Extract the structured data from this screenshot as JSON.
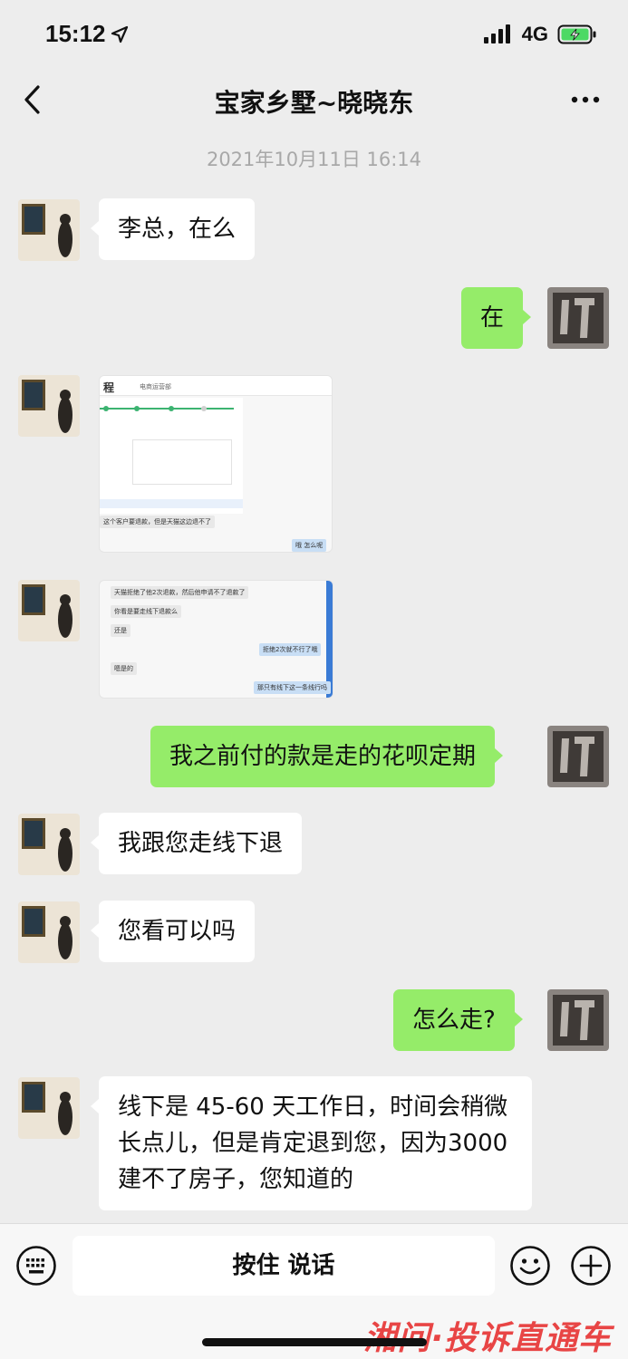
{
  "status": {
    "time": "15:12",
    "network": "4G"
  },
  "header": {
    "title": "宝家乡墅~晓晓东"
  },
  "chat": {
    "timestamp": "2021年10月11日 16:14",
    "messages": [
      {
        "side": "left",
        "type": "text",
        "text": "李总，在么"
      },
      {
        "side": "right",
        "type": "text",
        "text": "在"
      },
      {
        "side": "left",
        "type": "image",
        "content": {
          "title": "程",
          "dept": "电商运营部",
          "bubble_left": "这个客户要退款，但是天猫这边退不了",
          "bubble_right": "哦 怎么呢"
        }
      },
      {
        "side": "left",
        "type": "image",
        "content": {
          "lines": [
            {
              "side": "left",
              "text": "天猫拒绝了他2次退款，然后他申请不了退款了"
            },
            {
              "side": "left",
              "text": "你看是要走线下退款么"
            },
            {
              "side": "left",
              "text": "还是"
            },
            {
              "side": "right",
              "text": "拒绝2次就不行了哦"
            },
            {
              "side": "left",
              "text": "嗯是的"
            },
            {
              "side": "right",
              "text": "那只有线下这一条线行吗"
            }
          ]
        }
      },
      {
        "side": "right",
        "type": "text",
        "text": "我之前付的款是走的花呗定期"
      },
      {
        "side": "left",
        "type": "text",
        "text": "我跟您走线下退"
      },
      {
        "side": "left",
        "type": "text",
        "text": "您看可以吗"
      },
      {
        "side": "right",
        "type": "text",
        "text": "怎么走?"
      },
      {
        "side": "left",
        "type": "text",
        "text": "线下是 45-60 天工作日，时间会稍微长点儿，但是肯定退到您，因为3000 建不了房子，您知道的"
      }
    ]
  },
  "input": {
    "hold_to_talk": "按住 说话"
  },
  "watermark": "湘问·投诉直通车",
  "colors": {
    "background": "#ededed",
    "bubble_self": "#95ec69",
    "bubble_other": "#ffffff",
    "timestamp": "#a8a8a8"
  },
  "icons": [
    "location-arrow-icon",
    "signal-icon",
    "battery-charging-icon",
    "back-chevron-icon",
    "more-icon",
    "keyboard-icon",
    "emoji-icon",
    "plus-icon"
  ]
}
